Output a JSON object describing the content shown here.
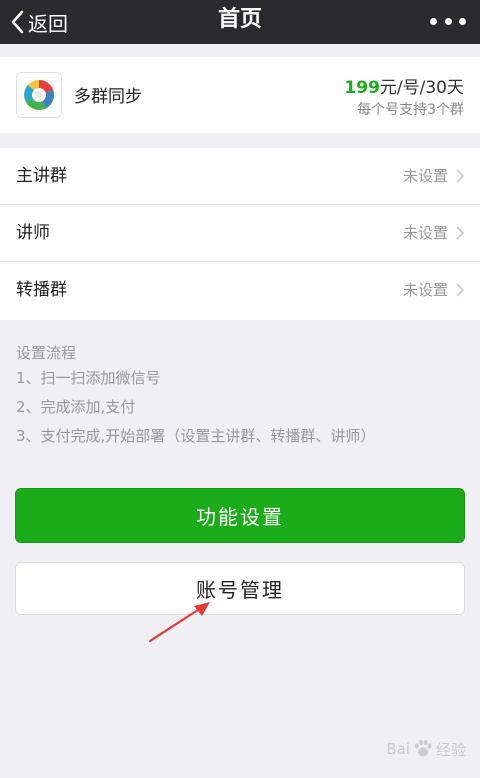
{
  "nav": {
    "back_label": "返回",
    "title": "首页",
    "more_icon": "more-dots-icon"
  },
  "product": {
    "name": "多群同步",
    "price_amount": "199",
    "price_unit": "元/号/30天",
    "price_note": "每个号支持3个群"
  },
  "settings": [
    {
      "label": "主讲群",
      "value": "未设置"
    },
    {
      "label": "讲师",
      "value": "未设置"
    },
    {
      "label": "转播群",
      "value": "未设置"
    }
  ],
  "process": {
    "title": "设置流程",
    "steps": [
      "1、扫一扫添加微信号",
      "2、完成添加,支付",
      "3、支付完成,开始部署（设置主讲群、转播群、讲师）"
    ]
  },
  "buttons": {
    "primary": "功能设置",
    "secondary": "账号管理"
  },
  "watermark": {
    "text_left": "Bai",
    "text_right": "经验"
  },
  "colors": {
    "navbar": "#2b2b2f",
    "accent_green": "#1aad19",
    "background": "#efeff4",
    "annotation_red": "#e53935"
  }
}
